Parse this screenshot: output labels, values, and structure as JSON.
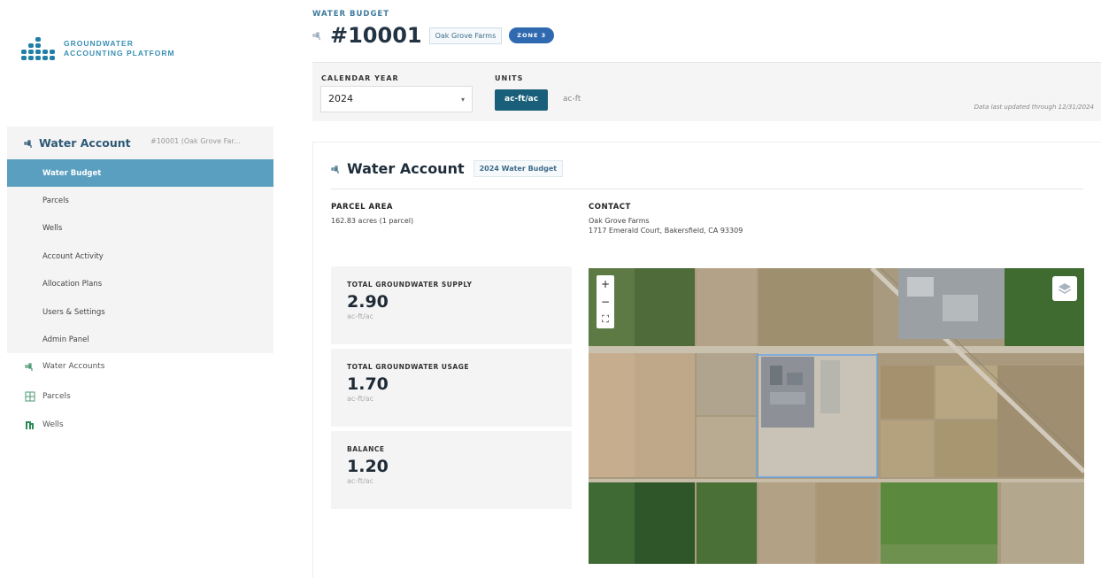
{
  "app": {
    "logo_line1": "GROUNDWATER",
    "logo_line2": "ACCOUNTING PLATFORM"
  },
  "sidebar": {
    "account_header": "Water Account",
    "account_selector": "#10001 (Oak Grove Far...",
    "account_items": [
      {
        "label": "Water Budget",
        "active": true
      },
      {
        "label": "Parcels"
      },
      {
        "label": "Wells"
      },
      {
        "label": "Account Activity"
      },
      {
        "label": "Allocation Plans"
      },
      {
        "label": "Users & Settings"
      },
      {
        "label": "Admin Panel"
      }
    ],
    "nav": [
      {
        "label": "Water Accounts",
        "icon": "water-tap-icon"
      },
      {
        "label": "Parcels",
        "icon": "grid-icon"
      },
      {
        "label": "Wells",
        "icon": "well-icon"
      }
    ]
  },
  "header": {
    "breadcrumb": "WATER BUDGET",
    "account_number": "#10001",
    "farm": "Oak Grove Farms",
    "zone": "ZONE 3"
  },
  "filters": {
    "year_label": "CALENDAR YEAR",
    "year_value": "2024",
    "units_label": "UNITS",
    "unit_selected": "ac-ft/ac",
    "unit_other": "ac-ft",
    "updated": "Data last updated through 12/31/2024"
  },
  "card": {
    "title": "Water Account",
    "budget_chip": "2024 Water Budget",
    "parcel_area_label": "PARCEL AREA",
    "parcel_area_value": "162.83 acres (1 parcel)",
    "contact_label": "CONTACT",
    "contact_name": "Oak Grove Farms",
    "contact_address": "1717 Emerald Court, Bakersfield, CA 93309",
    "stats": [
      {
        "label": "TOTAL GROUNDWATER SUPPLY",
        "value": "2.90",
        "unit": "ac-ft/ac"
      },
      {
        "label": "TOTAL GROUNDWATER USAGE",
        "value": "1.70",
        "unit": "ac-ft/ac"
      },
      {
        "label": "BALANCE",
        "value": "1.20",
        "unit": "ac-ft/ac"
      }
    ]
  },
  "map": {
    "zoom_in": "+",
    "zoom_out": "−",
    "fullscreen": "⛶"
  },
  "colors": {
    "accent": "#1a5f7a",
    "active_nav": "#5a9fc0",
    "zone": "#2f6ab0"
  }
}
